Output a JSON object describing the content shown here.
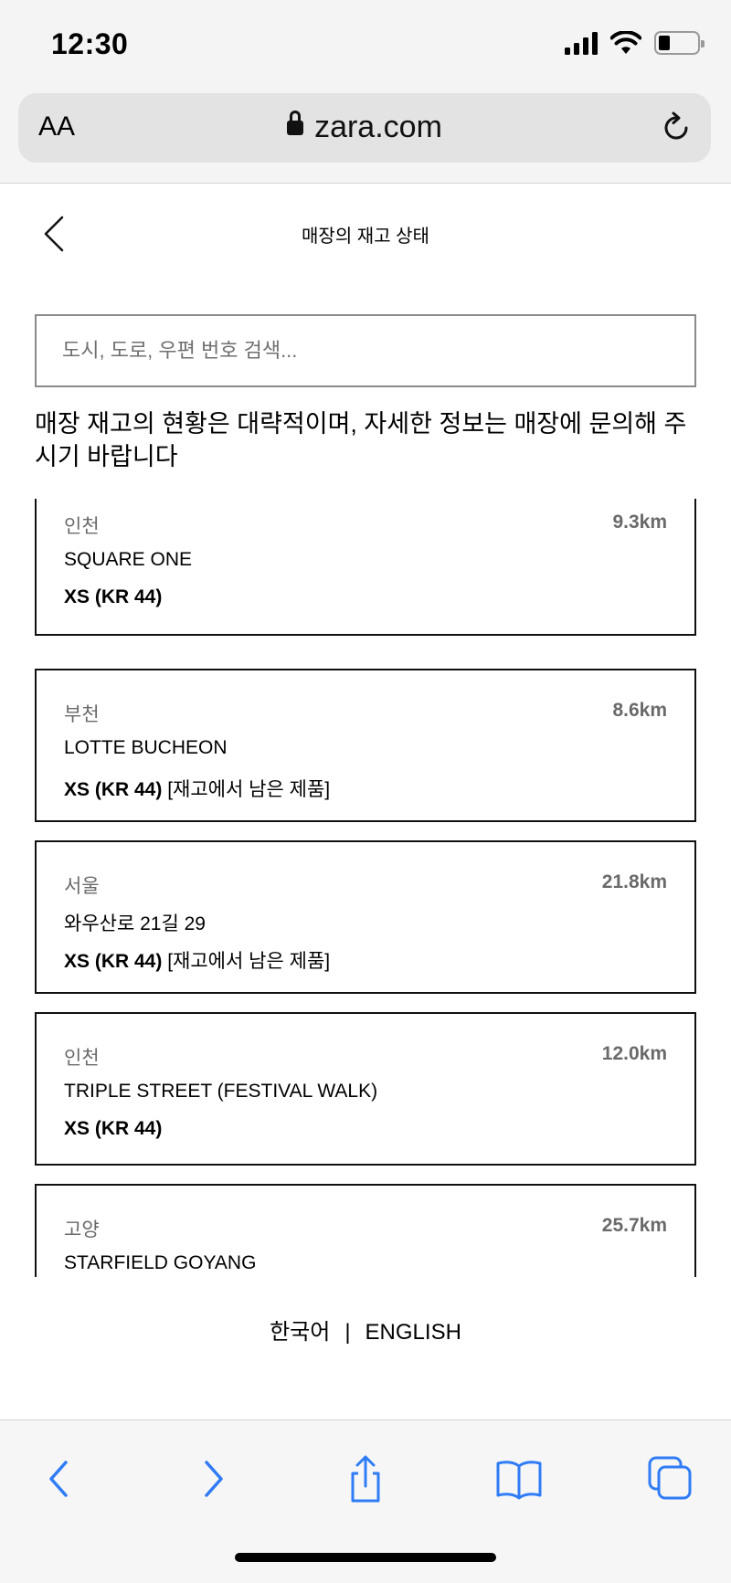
{
  "status": {
    "time": "12:30"
  },
  "browser": {
    "aa_label": "AA",
    "host": "zara.com"
  },
  "page": {
    "title": "매장의 재고 상태"
  },
  "search": {
    "placeholder": "도시, 도로, 우편 번호 검색..."
  },
  "notice": "매장 재고의 현황은 대략적이며, 자세한 정보는 매장에 문의해 주시기 바랍니다",
  "stores": [
    {
      "city": "인천",
      "distance": "9.3km",
      "name": "SQUARE ONE",
      "size": "XS (KR 44)",
      "stock_note": ""
    },
    {
      "city": "부천",
      "distance": "8.6km",
      "name": "LOTTE BUCHEON",
      "size": "XS (KR 44)",
      "stock_note": "[재고에서 남은 제품]"
    },
    {
      "city": "서울",
      "distance": "21.8km",
      "name": "와우산로 21길 29",
      "size": "XS (KR 44)",
      "stock_note": "[재고에서 남은 제품]"
    },
    {
      "city": "인천",
      "distance": "12.0km",
      "name": "TRIPLE STREET (FESTIVAL WALK)",
      "size": "XS (KR 44)",
      "stock_note": ""
    },
    {
      "city": "고양",
      "distance": "25.7km",
      "name": "STARFIELD GOYANG",
      "size": "",
      "stock_note": ""
    }
  ],
  "languages": {
    "korean": "한국어",
    "separator": "|",
    "english": "ENGLISH"
  },
  "colors": {
    "accent": "#2f7cf6",
    "border": "#111111",
    "muted": "#6a6a6a"
  }
}
